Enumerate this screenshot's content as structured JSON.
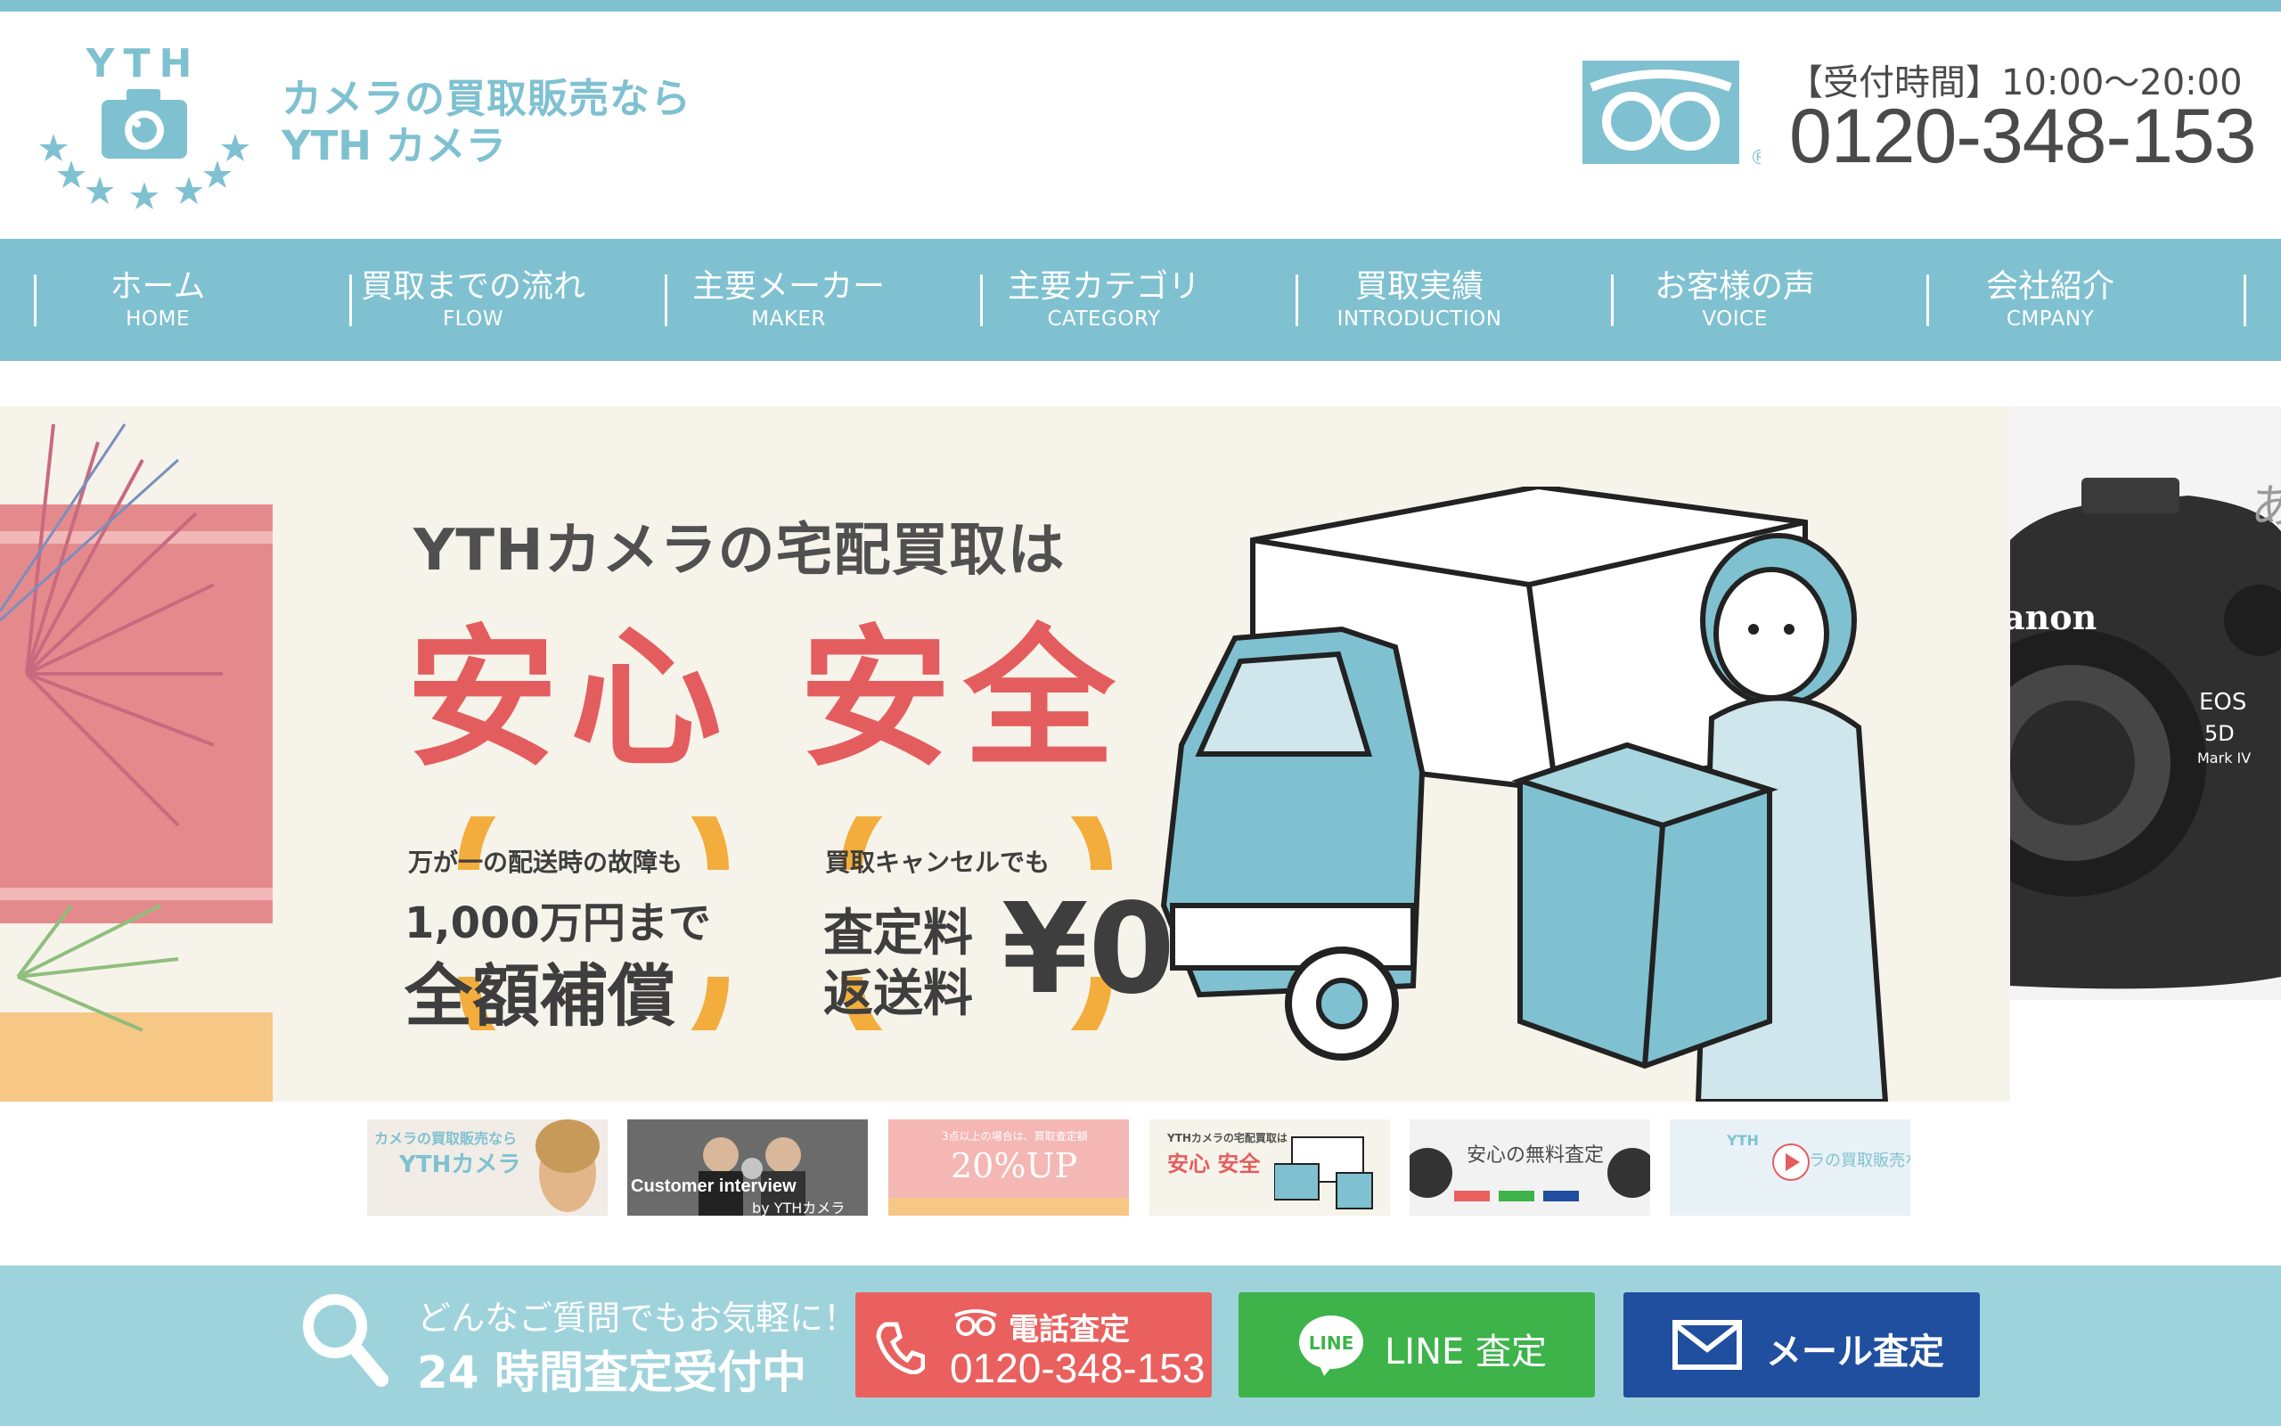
{
  "header": {
    "logo_mark": "YTH",
    "tagline": "カメラの買取販売なら",
    "brand_name": "YTH カメラ",
    "hours_label": "【受付時間】10:00〜20:00",
    "phone": "0120-348-153",
    "freedial_mark": "®"
  },
  "nav": {
    "items": [
      {
        "label": "ホーム",
        "sub": "HOME"
      },
      {
        "label": "買取までの流れ",
        "sub": "FLOW"
      },
      {
        "label": "主要メーカー",
        "sub": "MAKER"
      },
      {
        "label": "主要カテゴリ",
        "sub": "CATEGORY"
      },
      {
        "label": "買取実績",
        "sub": "INTRODUCTION"
      },
      {
        "label": "お客様の声",
        "sub": "VOICE"
      },
      {
        "label": "会社紹介",
        "sub": "CMPANY"
      }
    ]
  },
  "hero": {
    "headline": "YTHカメラの宅配買取は",
    "big": "安心 安全",
    "badge1": {
      "small": "万が一の配送時の故障も",
      "mid": "1,000万円まで",
      "big": "全額補償"
    },
    "badge2": {
      "small": "買取キャンセルでも",
      "line1": "査定料",
      "line2": "返送料",
      "yen": "¥0"
    },
    "right_peek_char": "あ",
    "camera_text": {
      "brand": "anon",
      "model1": "EOS",
      "model2": "5D",
      "model3": "Mark IV"
    }
  },
  "thumbnails": [
    {
      "title": "カメラの買取販売なら",
      "sub": "YTHカメラ"
    },
    {
      "title": "Customer interview",
      "sub": "by YTHカメラ"
    },
    {
      "title": "3点以上の場合は、買取査定額",
      "sub": "20%UP"
    },
    {
      "title": "YTHカメラの宅配買取は",
      "sub": "安心 安全"
    },
    {
      "title": "安心の無料査定",
      "sub": ""
    },
    {
      "title": "YTH",
      "sub": "カメラの買取販売なら"
    }
  ],
  "footer": {
    "note": "どんなご質問でもお気軽に！",
    "note2": "24 時間査定受付中",
    "tel_label": "電話査定",
    "tel_number": "0120-348-153",
    "line_icon_text": "LINE",
    "line_label": "LINE 査定",
    "mail_label": "メール査定"
  },
  "colors": {
    "accent": "#7fc1d0",
    "footer_bg": "#9fd3dc",
    "red": "#e45d5e",
    "line_green": "#3db34a",
    "mail_blue": "#1f4f9e"
  }
}
